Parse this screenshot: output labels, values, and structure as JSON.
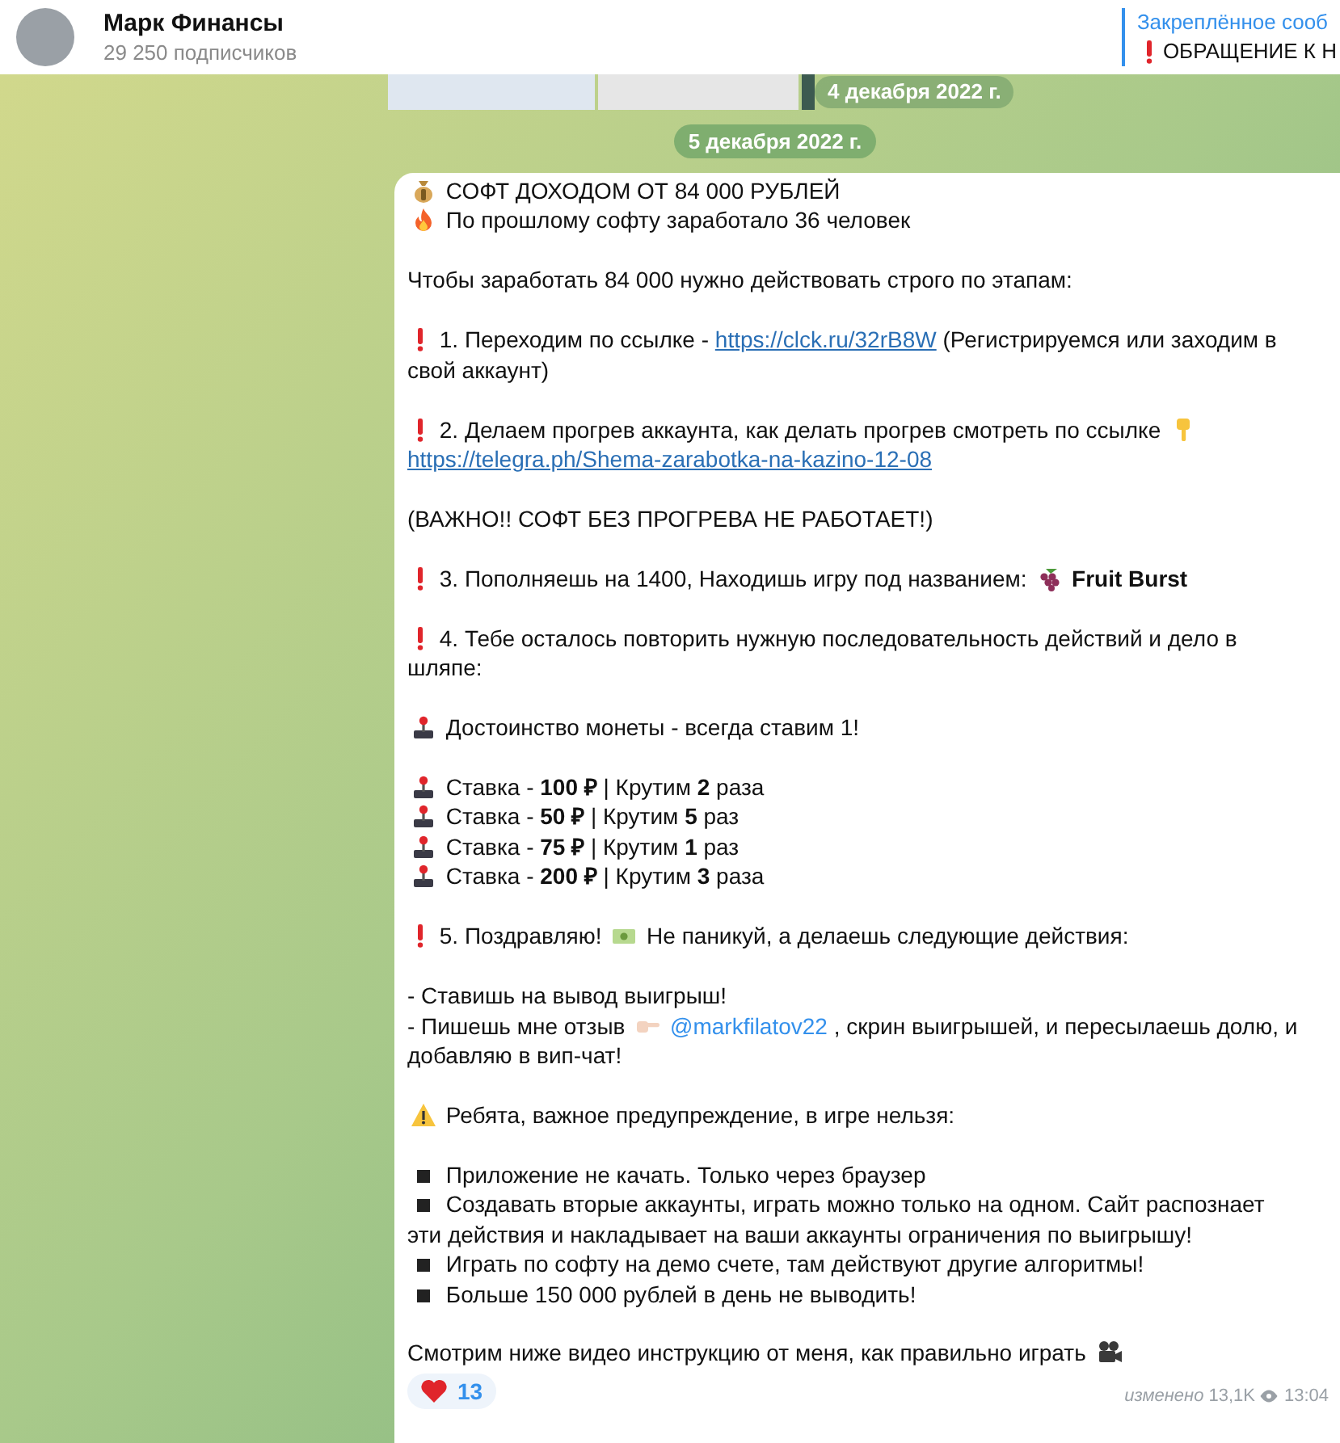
{
  "channel": {
    "name": "Марк Финансы",
    "subscribers": "29 250 подписчиков"
  },
  "pinned": {
    "title": "Закреплённое сооб",
    "text": "ОБРАЩЕНИЕ К Н"
  },
  "previous_album": {
    "date": "4 декабря 2022 г."
  },
  "date_separator": "5 декабря 2022 г.",
  "message": {
    "lines": [
      {
        "kind": "paragraph",
        "parts": [
          {
            "kind": "money-bag"
          },
          {
            "kind": "text",
            "text": "СОФТ ДОХОДОМ ОТ 84 000 РУБЛЕЙ"
          }
        ]
      },
      {
        "kind": "paragraph",
        "parts": [
          {
            "kind": "fire"
          },
          {
            "kind": "text",
            "text": "По прошлому софту заработало 36 человек"
          }
        ]
      },
      {
        "kind": "blank"
      },
      {
        "kind": "paragraph",
        "parts": [
          {
            "kind": "text",
            "text": "Чтобы заработать 84 000 нужно действовать строго по этапам:"
          }
        ]
      },
      {
        "kind": "blank"
      },
      {
        "kind": "paragraph",
        "parts": [
          {
            "kind": "exclaim"
          },
          {
            "kind": "text",
            "text": "1. Переходим по ссылке -"
          },
          {
            "kind": "link",
            "text": "https://clck.ru/32rB8W"
          },
          {
            "kind": "text",
            "text": "(Регистрируемся или заходим в"
          },
          {
            "kind": "break"
          },
          {
            "kind": "text",
            "text": "свой аккаунт)"
          }
        ]
      },
      {
        "kind": "blank"
      },
      {
        "kind": "paragraph",
        "parts": [
          {
            "kind": "exclaim"
          },
          {
            "kind": "text",
            "text": "2. Делаем прогрев аккаунта, как делать прогрев смотреть по ссылке"
          },
          {
            "kind": "point-down"
          },
          {
            "kind": "break"
          },
          {
            "kind": "link",
            "text": "https://telegra.ph/Shema-zarabotka-na-kazino-12-08"
          }
        ]
      },
      {
        "kind": "blank"
      },
      {
        "kind": "paragraph",
        "parts": [
          {
            "kind": "text",
            "text": "(ВАЖНО!! СОФТ БЕЗ ПРОГРЕВА НЕ РАБОТАЕТ!)"
          }
        ]
      },
      {
        "kind": "blank"
      },
      {
        "kind": "paragraph",
        "parts": [
          {
            "kind": "exclaim"
          },
          {
            "kind": "text",
            "text": "3. Пополняешь на 1400, Находишь игру под названием:"
          },
          {
            "kind": "grapes"
          },
          {
            "kind": "text",
            "text": "**Fruit Burst**"
          }
        ]
      },
      {
        "kind": "blank"
      },
      {
        "kind": "paragraph",
        "parts": [
          {
            "kind": "exclaim"
          },
          {
            "kind": "text",
            "text": "4. Тебе осталось повторить нужную последовательность действий и дело в"
          },
          {
            "kind": "break"
          },
          {
            "kind": "text",
            "text": "шляпе:"
          }
        ]
      },
      {
        "kind": "blank"
      },
      {
        "kind": "paragraph",
        "parts": [
          {
            "kind": "joystick"
          },
          {
            "kind": "text",
            "text": "Достоинство монеты - всегда ставим 1!"
          }
        ]
      },
      {
        "kind": "blank"
      },
      {
        "kind": "paragraph",
        "parts": [
          {
            "kind": "joystick"
          },
          {
            "kind": "text",
            "text": "Ставка - **100 ₽** | Крутим **2** раза"
          }
        ]
      },
      {
        "kind": "paragraph",
        "parts": [
          {
            "kind": "joystick"
          },
          {
            "kind": "text",
            "text": "Ставка - **50 ₽** | Крутим **5** раз"
          }
        ]
      },
      {
        "kind": "paragraph",
        "parts": [
          {
            "kind": "joystick"
          },
          {
            "kind": "text",
            "text": "Ставка - **75 ₽** | Крутим **1** раз"
          }
        ]
      },
      {
        "kind": "paragraph",
        "parts": [
          {
            "kind": "joystick"
          },
          {
            "kind": "text",
            "text": "Ставка - **200 ₽** | Крутим **3** раза"
          }
        ]
      },
      {
        "kind": "blank"
      },
      {
        "kind": "paragraph",
        "parts": [
          {
            "kind": "exclaim"
          },
          {
            "kind": "text",
            "text": "5. Поздравляю!"
          },
          {
            "kind": "banknote"
          },
          {
            "kind": "text",
            "text": "Не паникуй, а делаешь следующие действия:"
          }
        ]
      },
      {
        "kind": "blank"
      },
      {
        "kind": "paragraph",
        "parts": [
          {
            "kind": "text",
            "text": "- Ставишь на вывод выигрыш!"
          }
        ]
      },
      {
        "kind": "paragraph",
        "parts": [
          {
            "kind": "text",
            "text": "- Пишешь мне отзыв"
          },
          {
            "kind": "point-right"
          },
          {
            "kind": "mention",
            "text": "@markfilatov22"
          },
          {
            "kind": "text",
            "text": ", скрин выигрышей, и пересылаешь долю, и"
          },
          {
            "kind": "break"
          },
          {
            "kind": "text",
            "text": "добавляю в вип-чат!"
          }
        ]
      },
      {
        "kind": "blank"
      },
      {
        "kind": "paragraph",
        "parts": [
          {
            "kind": "warning"
          },
          {
            "kind": "text",
            "text": "Ребята, важное предупреждение, в игре нельзя:"
          }
        ]
      },
      {
        "kind": "blank"
      },
      {
        "kind": "paragraph",
        "parts": [
          {
            "kind": "square"
          },
          {
            "kind": "text",
            "text": "Приложение не качать. Только через браузер"
          }
        ]
      },
      {
        "kind": "paragraph",
        "parts": [
          {
            "kind": "square"
          },
          {
            "kind": "text",
            "text": "Создавать вторые аккаунты, играть можно только на одном. Сайт распознает"
          },
          {
            "kind": "break"
          },
          {
            "kind": "text",
            "text": "эти действия и накладывает на ваши аккаунты ограничения по выигрышу!"
          }
        ]
      },
      {
        "kind": "paragraph",
        "parts": [
          {
            "kind": "square"
          },
          {
            "kind": "text",
            "text": "Играть по софту на демо счете, там действуют другие алгоритмы!"
          }
        ]
      },
      {
        "kind": "paragraph",
        "parts": [
          {
            "kind": "square"
          },
          {
            "kind": "text",
            "text": "Больше 150 000 рублей в день не выводить!"
          }
        ]
      },
      {
        "kind": "blank"
      },
      {
        "kind": "paragraph",
        "parts": [
          {
            "kind": "text",
            "text": "Смотрим ниже видео инструкцию от меня, как правильно играть"
          },
          {
            "kind": "movie-camera"
          }
        ]
      }
    ],
    "reaction": {
      "count": "13"
    },
    "footer": {
      "edited": "изменено",
      "views": "13,1K",
      "time": "13:04"
    }
  }
}
